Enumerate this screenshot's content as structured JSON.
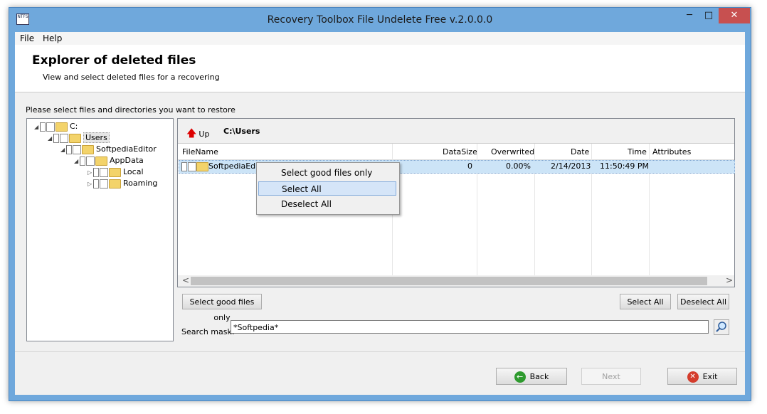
{
  "window": {
    "title": "Recovery Toolbox File Undelete Free v.2.0.0.0",
    "app_icon_text": "NTFS",
    "min_glyph": "─",
    "max_glyph": "□",
    "close_glyph": "✕"
  },
  "menu": [
    "File",
    "Help"
  ],
  "header": {
    "title": "Explorer of deleted files",
    "subtitle": "View and select deleted files for a recovering"
  },
  "instruction": "Please select files and directories you want to restore",
  "tree": [
    {
      "label": "C:",
      "expand": "◢"
    },
    {
      "label": "Users",
      "expand": "◢",
      "selected": true
    },
    {
      "label": "SoftpediaEditor",
      "expand": "◢"
    },
    {
      "label": "AppData",
      "expand": "◢"
    },
    {
      "label": "Local",
      "expand": "▷"
    },
    {
      "label": "Roaming",
      "expand": "▷"
    }
  ],
  "toolbar": {
    "up_label": "Up",
    "up_glyph": "🡅",
    "path": "C:\\Users"
  },
  "columns": [
    "FileName",
    "DataSize",
    "Overwrited",
    "Date",
    "Time",
    "Attributes"
  ],
  "rows": [
    {
      "name": "SoftpediaEdito",
      "datasize": "0",
      "overwrited": "0.00%",
      "date": "2/14/2013",
      "time": "11:50:49 PM",
      "attributes": ""
    }
  ],
  "scroll": {
    "left": "<",
    "right": ">"
  },
  "context_menu": {
    "items": [
      "Select good files only",
      "Select All",
      "Deselect All"
    ],
    "highlighted": 1
  },
  "buttons": {
    "select_good": "Select good files only",
    "select_all": "Select All",
    "deselect_all": "Deselect All"
  },
  "search": {
    "label": "Search mask:",
    "value": "*Softpedia*"
  },
  "nav": {
    "back": "Back",
    "next": "Next",
    "exit": "Exit",
    "back_glyph": "←",
    "exit_glyph": "✕"
  },
  "colors": {
    "selection": "#cce4f7",
    "titlebar": "#6fa8dc",
    "close": "#c75050"
  }
}
